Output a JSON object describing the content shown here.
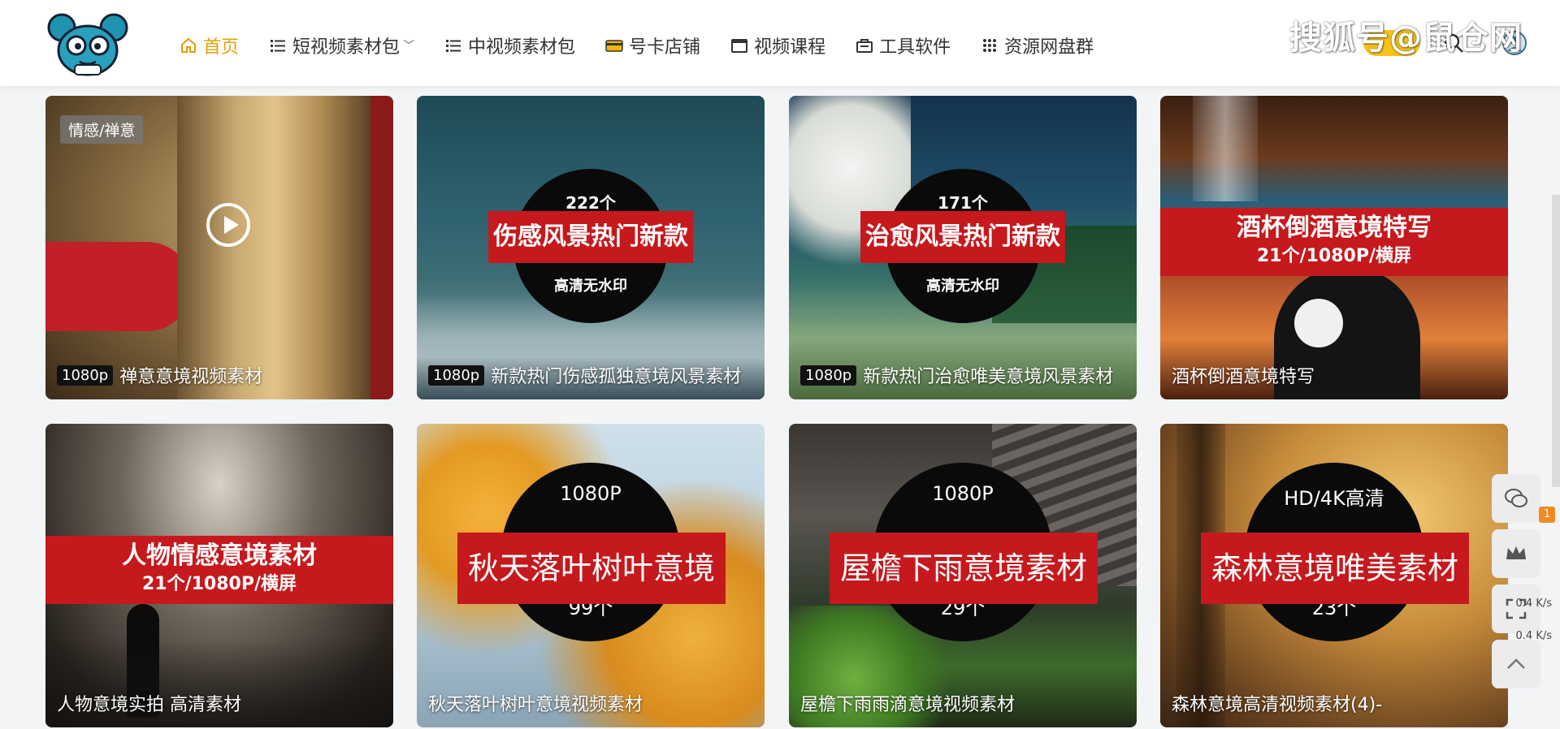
{
  "header": {
    "nav": [
      {
        "label": "首页",
        "icon": "home-icon",
        "active": true
      },
      {
        "label": "短视频素材包",
        "icon": "list-icon",
        "has_dropdown": true
      },
      {
        "label": "中视频素材包",
        "icon": "list-icon"
      },
      {
        "label": "号卡店铺",
        "icon": "card-icon"
      },
      {
        "label": "视频课程",
        "icon": "video-icon"
      },
      {
        "label": "工具软件",
        "icon": "toolbox-icon"
      },
      {
        "label": "资源网盘群",
        "icon": "grid-icon"
      }
    ],
    "watermark": "搜狐号@鼠仓网",
    "colors": {
      "accent": "#e0a100",
      "vip": "#f7c31a"
    }
  },
  "cards": [
    {
      "category": "情感/禅意",
      "resolution": "1080p",
      "title": "禅意意境视频素材",
      "has_play": true
    },
    {
      "resolution": "1080p",
      "title": "新款热门伤感孤独意境风景素材",
      "overlay": {
        "top": "222个",
        "bar": "伤感风景热门新款",
        "bottom": "高清无水印"
      }
    },
    {
      "resolution": "1080p",
      "title": "新款热门治愈唯美意境风景素材",
      "overlay": {
        "top": "171个",
        "bar": "治愈风景热门新款",
        "bottom": "高清无水印"
      }
    },
    {
      "title": "酒杯倒酒意境特写",
      "banner": {
        "line1": "酒杯倒酒意境特写",
        "line2": "21个/1080P/横屏"
      }
    },
    {
      "title": "人物意境实拍 高清素材",
      "banner": {
        "line1": "人物情感意境素材",
        "line2": "21个/1080P/横屏"
      }
    },
    {
      "title": "秋天落叶树叶意境视频素材",
      "overlay": {
        "top": "1080P",
        "bar": "秋天落叶树叶意境",
        "bottom": "99个"
      }
    },
    {
      "title": "屋檐下雨雨滴意境视频素材",
      "overlay": {
        "top": "1080P",
        "bar": "屋檐下雨意境素材",
        "bottom": "29个"
      }
    },
    {
      "title": "森林意境高清视频素材(4)-",
      "overlay": {
        "top": "HD/4K高清",
        "bar": "森林意境唯美素材",
        "bottom": "23个"
      }
    }
  ],
  "float_tools": {
    "badge": "1",
    "speed_up": "0.4",
    "speed_down": "0.4",
    "speed_unit": "K/s"
  }
}
